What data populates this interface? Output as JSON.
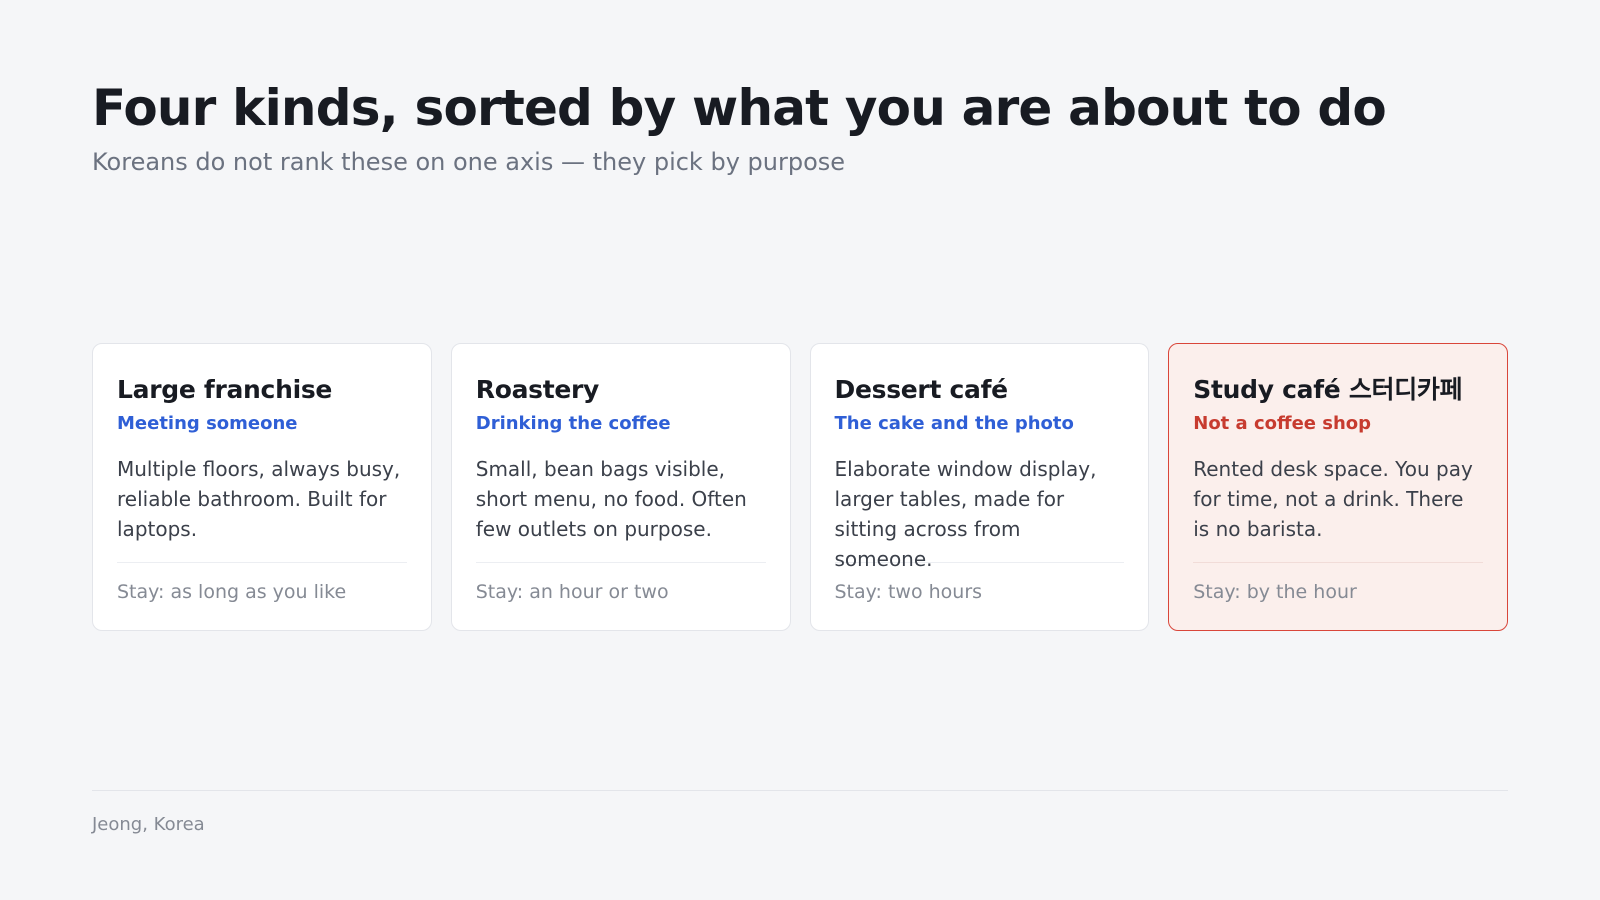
{
  "header": {
    "title": "Four kinds, sorted by what you are about to do",
    "subtitle": "Koreans do not rank these on one axis — they pick by purpose"
  },
  "cards": [
    {
      "title": "Large franchise",
      "tag": "Meeting someone",
      "description": "Multiple floors, always busy, reliable bathroom. Built for laptops.",
      "stay": "Stay: as long as you like"
    },
    {
      "title": "Roastery",
      "tag": "Drinking the coffee",
      "description": "Small, bean bags visible, short menu, no food. Often few outlets on purpose.",
      "stay": "Stay: an hour or two"
    },
    {
      "title": "Dessert café",
      "tag": "The cake and the photo",
      "description": "Elaborate window display, larger tables, made for sitting across from someone.",
      "stay": "Stay: two hours"
    },
    {
      "title": "Study café 스터디카페",
      "tag": "Not a coffee shop",
      "description": "Rented desk space. You pay for time, not a drink. There is no barista.",
      "stay": "Stay: by the hour"
    }
  ],
  "colors": {
    "accent_blue": "#2f5fd6",
    "alert_red": "#c73b2f",
    "alert_border": "#d9463a",
    "alert_background": "#fbefec"
  },
  "footer": {
    "credit": "Jeong, Korea"
  }
}
